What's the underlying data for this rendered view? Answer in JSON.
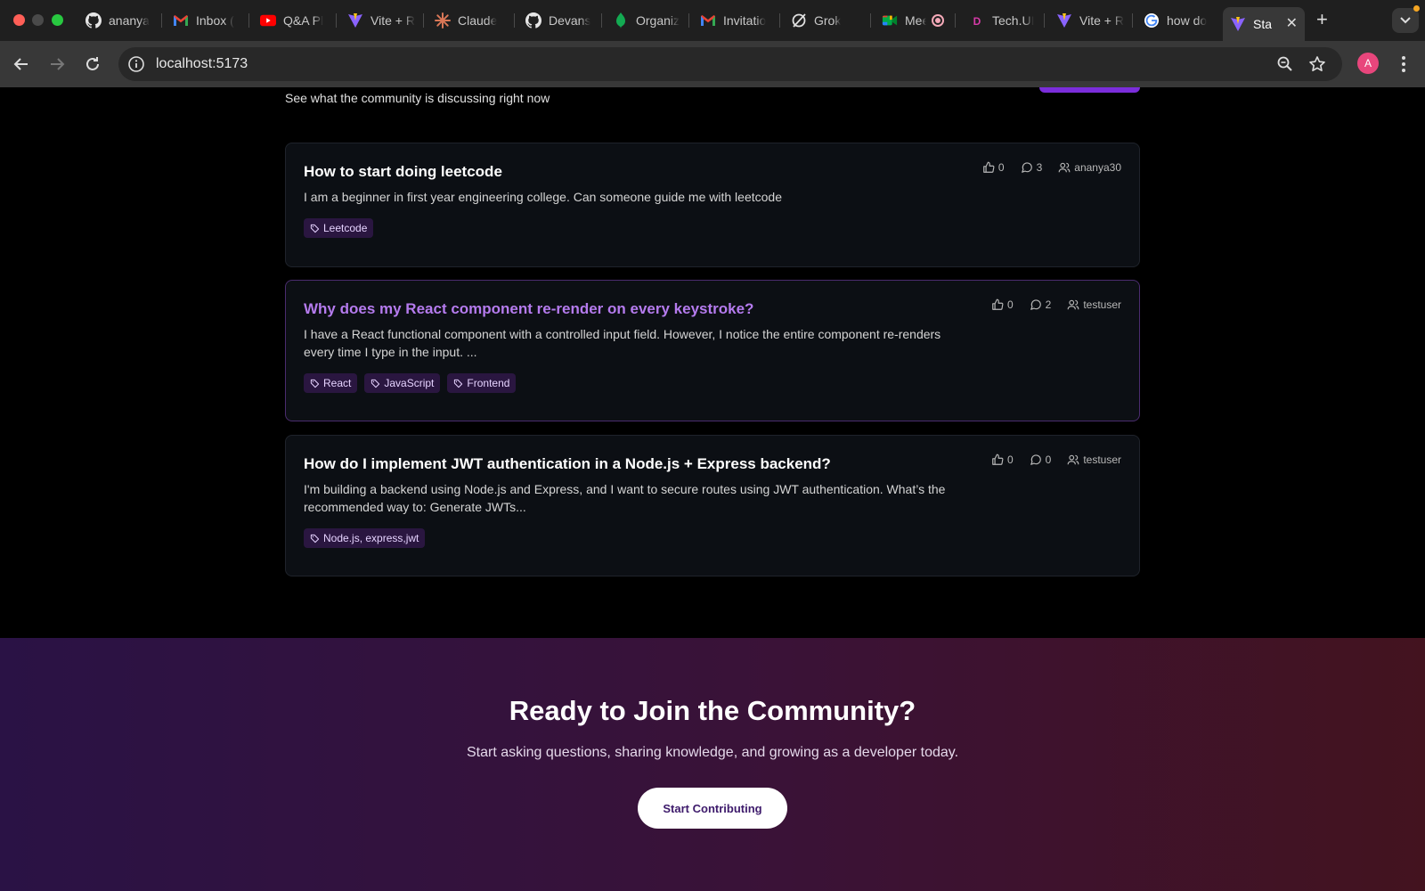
{
  "browser": {
    "tabs": [
      {
        "label": "ananya",
        "icon": "github-icon"
      },
      {
        "label": "Inbox (",
        "icon": "gmail-icon"
      },
      {
        "label": "Q&A Pl",
        "icon": "youtube-icon"
      },
      {
        "label": "Vite + R",
        "icon": "vite-icon"
      },
      {
        "label": "Claude",
        "icon": "claude-icon"
      },
      {
        "label": "Devans",
        "icon": "github-icon"
      },
      {
        "label": "Organiz",
        "icon": "mongodb-icon"
      },
      {
        "label": "Invitatio",
        "icon": "gmail-icon"
      },
      {
        "label": "Grok",
        "icon": "grok-icon"
      },
      {
        "label": "Mee",
        "icon": "google-meet-icon"
      },
      {
        "label": "Tech.UI",
        "icon": "tech-ui-icon"
      },
      {
        "label": "Vite + R",
        "icon": "vite-icon"
      },
      {
        "label": "how do",
        "icon": "google-icon"
      },
      {
        "label": "Sta",
        "icon": "vite-icon",
        "active": true
      }
    ],
    "url": "localhost:5173",
    "profile_initial": "A"
  },
  "page": {
    "subheading": "See what the community is discussing right now",
    "posts": [
      {
        "title": "How to start doing leetcode",
        "body": "I am a beginner in first year engineering college. Can someone guide me with leetcode",
        "likes": "0",
        "comments": "3",
        "author": "ananya30",
        "tags": [
          "Leetcode"
        ]
      },
      {
        "title": "Why does my React component re-render on every keystroke?",
        "body": "I have a React functional component with a controlled input field. However, I notice the entire component re-renders every time I type in the input. ...",
        "likes": "0",
        "comments": "2",
        "author": "testuser",
        "tags": [
          "React",
          "JavaScript",
          "Frontend"
        ]
      },
      {
        "title": "How do I implement JWT authentication in a Node.js + Express backend?",
        "body": "I'm building a backend using Node.js and Express, and I want to secure routes using JWT authentication. What’s the recommended way to: Generate JWTs...",
        "likes": "0",
        "comments": "0",
        "author": "testuser",
        "tags": [
          "Node.js, express,jwt"
        ]
      }
    ],
    "cta": {
      "title": "Ready to Join the Community?",
      "subtitle": "Start asking questions, sharing knowledge, and growing as a developer today.",
      "button": "Start Contributing"
    }
  },
  "colors": {
    "accent": "#7b2ddb",
    "highlight_title": "#b57bee",
    "tag_bg": "#2a1640"
  }
}
